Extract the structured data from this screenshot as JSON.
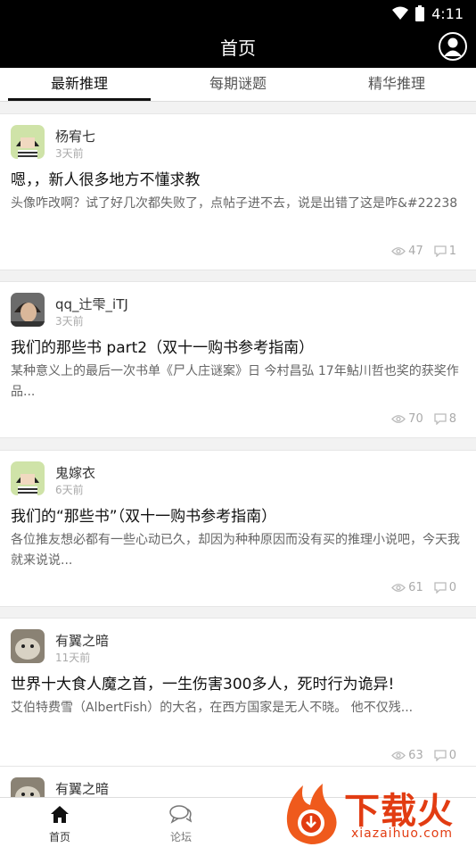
{
  "status_bar": {
    "time": "4:11"
  },
  "header": {
    "title": "首页"
  },
  "tabs": [
    {
      "label": "最新推理",
      "active": true
    },
    {
      "label": "每期谜题",
      "active": false
    },
    {
      "label": "精华推理",
      "active": false
    }
  ],
  "posts": [
    {
      "author": "杨宥七",
      "time": "3天前",
      "title": "嗯，，新人很多地方不懂求教",
      "excerpt": "头像咋改啊？试了好几次都失败了，点帖子进不去，说是出错了这是咋&#22238",
      "views": "47",
      "comments": "1"
    },
    {
      "author": "qq_辻雫_iTJ",
      "time": "3天前",
      "title": "我们的那些书 part2（双十一购书参考指南）",
      "excerpt": "某种意义上的最后一次书单《尸人庄谜案》日 今村昌弘  17年鮎川哲也奖的获奖作品...",
      "views": "70",
      "comments": "8"
    },
    {
      "author": "鬼嫁衣",
      "time": "6天前",
      "title": "我们的“那些书”（双十一购书参考指南）",
      "excerpt": "各位推友想必都有一些心动已久，却因为种种原因而没有买的推理小说吧，今天我就来说说...",
      "views": "61",
      "comments": "0"
    },
    {
      "author": "有翼之暗",
      "time": "11天前",
      "title": "世界十大食人魔之首，一生伤害300多人，死时行为诡异!",
      "excerpt": "艾伯特费雪（AlbertFish）的大名，在西方国家是无人不晓。   他不仅残...",
      "views": "63",
      "comments": "0"
    },
    {
      "author": "有翼之暗",
      "time": "",
      "title": "",
      "excerpt": "",
      "views": "",
      "comments": ""
    }
  ],
  "bottom_nav": [
    {
      "label": "首页",
      "icon": "home-icon",
      "active": true
    },
    {
      "label": "论坛",
      "icon": "forum-icon",
      "active": false
    }
  ],
  "watermark": {
    "text": "下载火",
    "subtext": "xiazaihuo.com"
  },
  "colors": {
    "header_bg": "#000000",
    "accent": "#111111",
    "watermark": "#e23c12"
  }
}
